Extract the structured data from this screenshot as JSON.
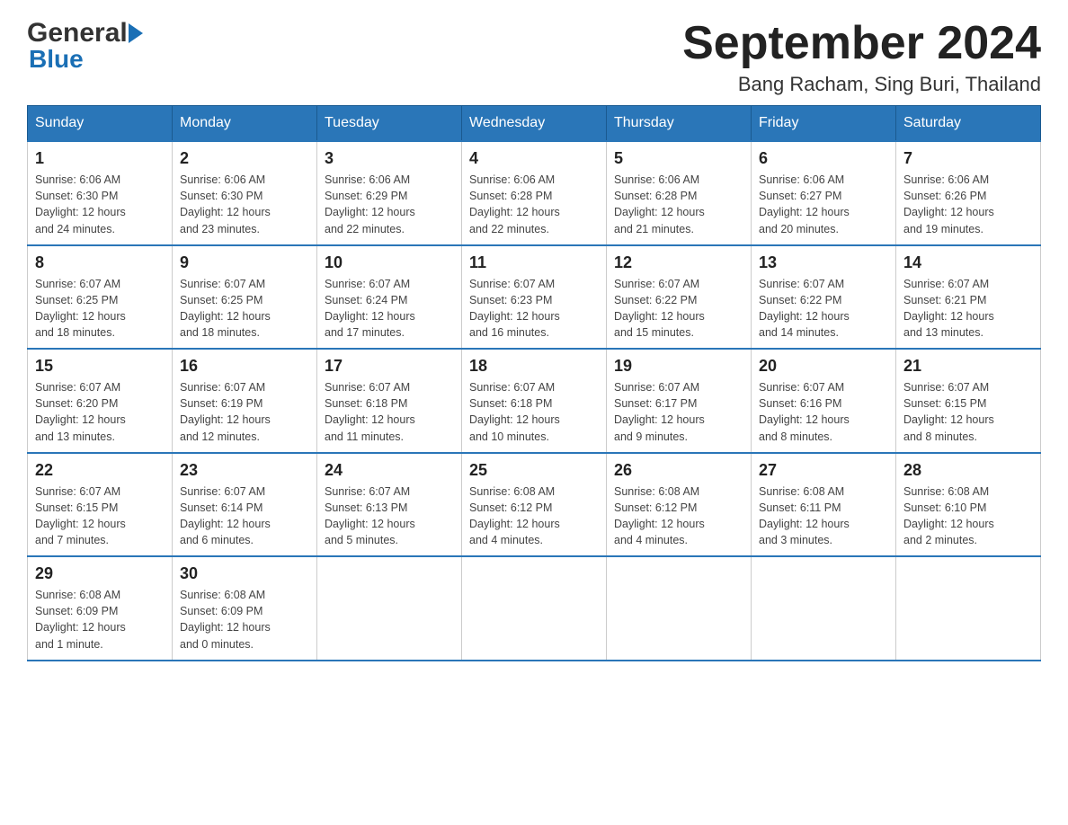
{
  "header": {
    "title": "September 2024",
    "subtitle": "Bang Racham, Sing Buri, Thailand",
    "logo_general": "General",
    "logo_blue": "Blue"
  },
  "days_of_week": [
    "Sunday",
    "Monday",
    "Tuesday",
    "Wednesday",
    "Thursday",
    "Friday",
    "Saturday"
  ],
  "weeks": [
    [
      {
        "day": "1",
        "sunrise": "6:06 AM",
        "sunset": "6:30 PM",
        "daylight": "12 hours and 24 minutes."
      },
      {
        "day": "2",
        "sunrise": "6:06 AM",
        "sunset": "6:30 PM",
        "daylight": "12 hours and 23 minutes."
      },
      {
        "day": "3",
        "sunrise": "6:06 AM",
        "sunset": "6:29 PM",
        "daylight": "12 hours and 22 minutes."
      },
      {
        "day": "4",
        "sunrise": "6:06 AM",
        "sunset": "6:28 PM",
        "daylight": "12 hours and 22 minutes."
      },
      {
        "day": "5",
        "sunrise": "6:06 AM",
        "sunset": "6:28 PM",
        "daylight": "12 hours and 21 minutes."
      },
      {
        "day": "6",
        "sunrise": "6:06 AM",
        "sunset": "6:27 PM",
        "daylight": "12 hours and 20 minutes."
      },
      {
        "day": "7",
        "sunrise": "6:06 AM",
        "sunset": "6:26 PM",
        "daylight": "12 hours and 19 minutes."
      }
    ],
    [
      {
        "day": "8",
        "sunrise": "6:07 AM",
        "sunset": "6:25 PM",
        "daylight": "12 hours and 18 minutes."
      },
      {
        "day": "9",
        "sunrise": "6:07 AM",
        "sunset": "6:25 PM",
        "daylight": "12 hours and 18 minutes."
      },
      {
        "day": "10",
        "sunrise": "6:07 AM",
        "sunset": "6:24 PM",
        "daylight": "12 hours and 17 minutes."
      },
      {
        "day": "11",
        "sunrise": "6:07 AM",
        "sunset": "6:23 PM",
        "daylight": "12 hours and 16 minutes."
      },
      {
        "day": "12",
        "sunrise": "6:07 AM",
        "sunset": "6:22 PM",
        "daylight": "12 hours and 15 minutes."
      },
      {
        "day": "13",
        "sunrise": "6:07 AM",
        "sunset": "6:22 PM",
        "daylight": "12 hours and 14 minutes."
      },
      {
        "day": "14",
        "sunrise": "6:07 AM",
        "sunset": "6:21 PM",
        "daylight": "12 hours and 13 minutes."
      }
    ],
    [
      {
        "day": "15",
        "sunrise": "6:07 AM",
        "sunset": "6:20 PM",
        "daylight": "12 hours and 13 minutes."
      },
      {
        "day": "16",
        "sunrise": "6:07 AM",
        "sunset": "6:19 PM",
        "daylight": "12 hours and 12 minutes."
      },
      {
        "day": "17",
        "sunrise": "6:07 AM",
        "sunset": "6:18 PM",
        "daylight": "12 hours and 11 minutes."
      },
      {
        "day": "18",
        "sunrise": "6:07 AM",
        "sunset": "6:18 PM",
        "daylight": "12 hours and 10 minutes."
      },
      {
        "day": "19",
        "sunrise": "6:07 AM",
        "sunset": "6:17 PM",
        "daylight": "12 hours and 9 minutes."
      },
      {
        "day": "20",
        "sunrise": "6:07 AM",
        "sunset": "6:16 PM",
        "daylight": "12 hours and 8 minutes."
      },
      {
        "day": "21",
        "sunrise": "6:07 AM",
        "sunset": "6:15 PM",
        "daylight": "12 hours and 8 minutes."
      }
    ],
    [
      {
        "day": "22",
        "sunrise": "6:07 AM",
        "sunset": "6:15 PM",
        "daylight": "12 hours and 7 minutes."
      },
      {
        "day": "23",
        "sunrise": "6:07 AM",
        "sunset": "6:14 PM",
        "daylight": "12 hours and 6 minutes."
      },
      {
        "day": "24",
        "sunrise": "6:07 AM",
        "sunset": "6:13 PM",
        "daylight": "12 hours and 5 minutes."
      },
      {
        "day": "25",
        "sunrise": "6:08 AM",
        "sunset": "6:12 PM",
        "daylight": "12 hours and 4 minutes."
      },
      {
        "day": "26",
        "sunrise": "6:08 AM",
        "sunset": "6:12 PM",
        "daylight": "12 hours and 4 minutes."
      },
      {
        "day": "27",
        "sunrise": "6:08 AM",
        "sunset": "6:11 PM",
        "daylight": "12 hours and 3 minutes."
      },
      {
        "day": "28",
        "sunrise": "6:08 AM",
        "sunset": "6:10 PM",
        "daylight": "12 hours and 2 minutes."
      }
    ],
    [
      {
        "day": "29",
        "sunrise": "6:08 AM",
        "sunset": "6:09 PM",
        "daylight": "12 hours and 1 minute."
      },
      {
        "day": "30",
        "sunrise": "6:08 AM",
        "sunset": "6:09 PM",
        "daylight": "12 hours and 0 minutes."
      },
      null,
      null,
      null,
      null,
      null
    ]
  ],
  "labels": {
    "sunrise": "Sunrise:",
    "sunset": "Sunset:",
    "daylight": "Daylight:"
  }
}
